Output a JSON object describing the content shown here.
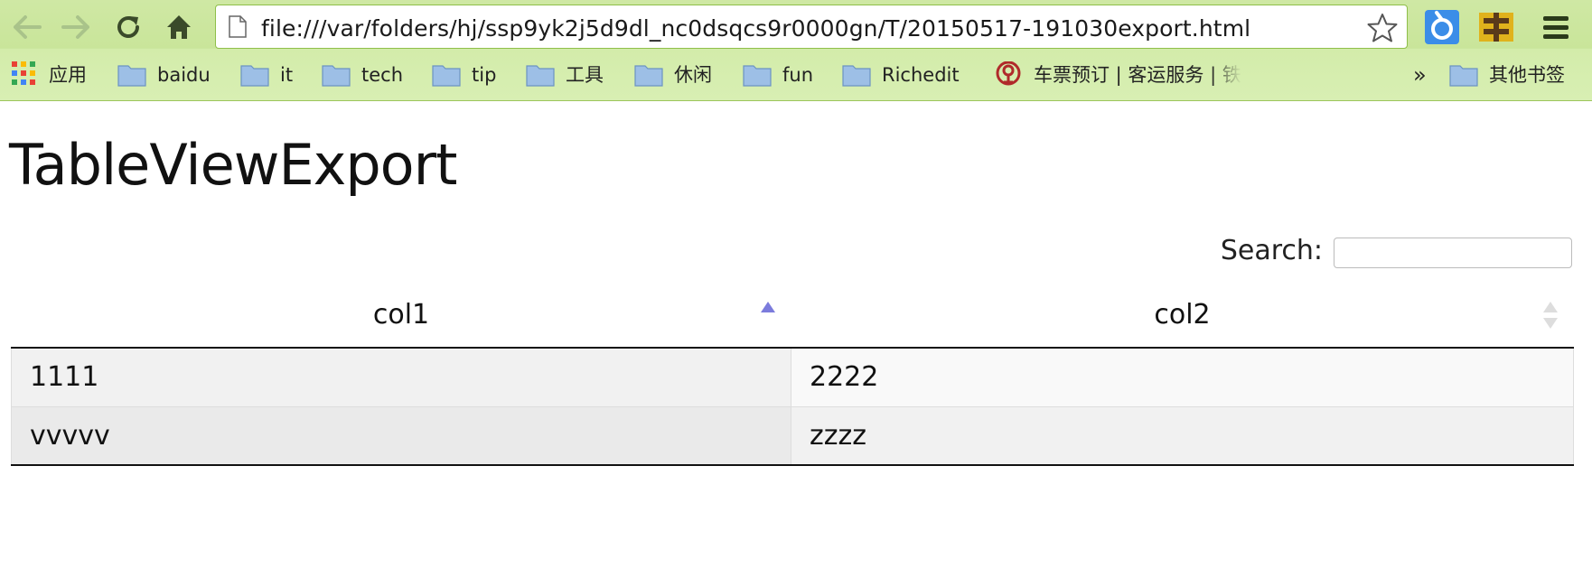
{
  "browser": {
    "url": "file:///var/folders/hj/ssp9yk2j5d9dl_nc0dsqcs9r0000gn/T/20150517-191030export.html",
    "bookmarks": [
      {
        "label": "应用",
        "icon": "apps-grid-icon"
      },
      {
        "label": "baidu",
        "icon": "folder-icon"
      },
      {
        "label": "it",
        "icon": "folder-icon"
      },
      {
        "label": "tech",
        "icon": "folder-icon"
      },
      {
        "label": "tip",
        "icon": "folder-icon"
      },
      {
        "label": "工具",
        "icon": "folder-icon"
      },
      {
        "label": "休闲",
        "icon": "folder-icon"
      },
      {
        "label": "fun",
        "icon": "folder-icon"
      },
      {
        "label": "Richedit",
        "icon": "folder-icon"
      },
      {
        "label": "车票预订 | 客运服务 | 铁",
        "icon": "railway-logo-icon"
      }
    ],
    "overflow_label": "»",
    "other_bookmarks_label": "其他书签",
    "colors": {
      "toolbar": "#cfe8a4",
      "url_border": "#8fbf4a"
    }
  },
  "page": {
    "title": "TableViewExport",
    "search": {
      "label": "Search:",
      "value": ""
    },
    "table": {
      "columns": [
        {
          "label": "col1",
          "sort": "ascending",
          "icon": "sort-ascending-icon"
        },
        {
          "label": "col2",
          "sort": "none",
          "icon": "sort-both-icon"
        }
      ],
      "rows": [
        [
          "1111",
          "2222"
        ],
        [
          "vvvvv",
          "zzzz"
        ]
      ]
    },
    "colors": {
      "sort_active": "#7b7bdc",
      "sort_inactive": "#dddddd"
    }
  }
}
